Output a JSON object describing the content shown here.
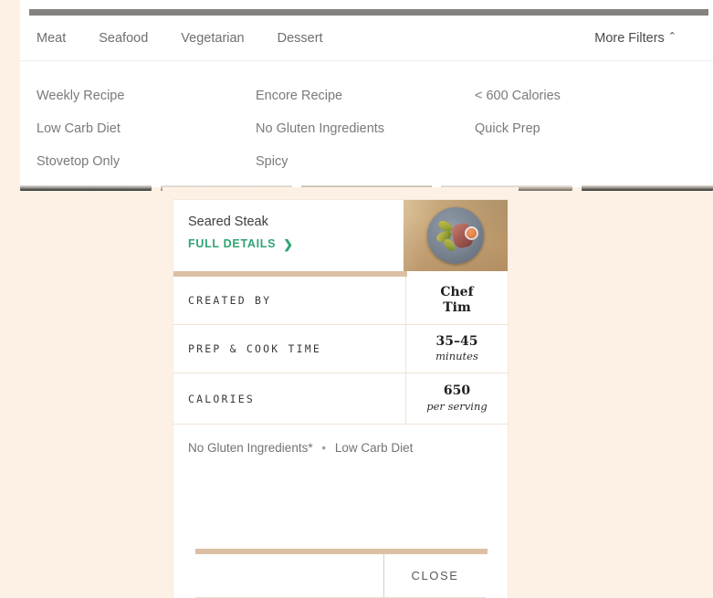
{
  "filter_bar": {
    "tabs": [
      {
        "label": "Meat"
      },
      {
        "label": "Seafood"
      },
      {
        "label": "Vegetarian"
      },
      {
        "label": "Dessert"
      }
    ],
    "more_filters_label": "More Filters",
    "more_filters_icon": "chevron-up-icon",
    "more_filters_chevron": "⌃",
    "options": [
      {
        "label": "Weekly Recipe"
      },
      {
        "label": "Encore Recipe"
      },
      {
        "label": "< 600 Calories"
      },
      {
        "label": "Low Carb Diet"
      },
      {
        "label": "No Gluten Ingredients"
      },
      {
        "label": "Quick Prep"
      },
      {
        "label": "Stovetop Only"
      },
      {
        "label": "Spicy"
      },
      {
        "label": ""
      }
    ]
  },
  "card": {
    "title": "Seared Steak",
    "details_link_label": "FULL DETAILS",
    "details_link_chevron": "❯",
    "photo_alt": "seared-steak-plate-photo",
    "specs": [
      {
        "label": "CREATED BY",
        "value": "Chef\nTim",
        "value_line1": "Chef",
        "value_line2": "Tim",
        "sub": ""
      },
      {
        "label": "PREP & COOK TIME",
        "value": "35–45",
        "value_line1": "35–45",
        "value_line2": "",
        "sub": "minutes"
      },
      {
        "label": "CALORIES",
        "value": "650",
        "value_line1": "650",
        "value_line2": "",
        "sub": "per serving"
      }
    ],
    "tags": {
      "first": "No Gluten Ingredients*",
      "separator": "•",
      "second": "Low Carb Diet"
    },
    "close_label": "CLOSE"
  },
  "colors": {
    "page_cream": "#fdf1e6",
    "accent_tan": "#dcbfa4",
    "link_green": "#2fa573",
    "top_bar_gray": "#84817e",
    "text_gray": "#7a7a7a"
  }
}
